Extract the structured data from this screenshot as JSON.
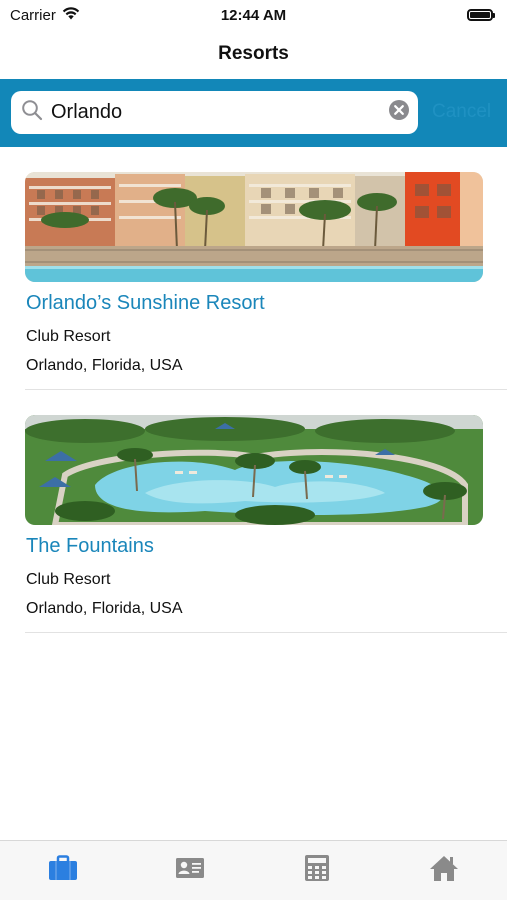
{
  "status_bar": {
    "carrier": "Carrier",
    "time": "12:44 AM"
  },
  "nav": {
    "title": "Resorts"
  },
  "search": {
    "value": "Orlando",
    "cancel_label": "Cancel"
  },
  "results": [
    {
      "name": "Orlando’s Sunshine Resort",
      "type": "Club Resort",
      "location": "Orlando, Florida, USA"
    },
    {
      "name": "The Fountains",
      "type": "Club Resort",
      "location": "Orlando, Florida, USA"
    }
  ],
  "tab_bar": {
    "tabs": [
      {
        "icon": "briefcase-icon",
        "selected": true
      },
      {
        "icon": "id-card-icon",
        "selected": false
      },
      {
        "icon": "calculator-icon",
        "selected": false
      },
      {
        "icon": "home-icon",
        "selected": false
      }
    ]
  },
  "colors": {
    "accent": "#1287b8",
    "link": "#1a86ba",
    "tab_selected": "#2b7fe0",
    "tab_unselected": "#8a8a8a"
  }
}
